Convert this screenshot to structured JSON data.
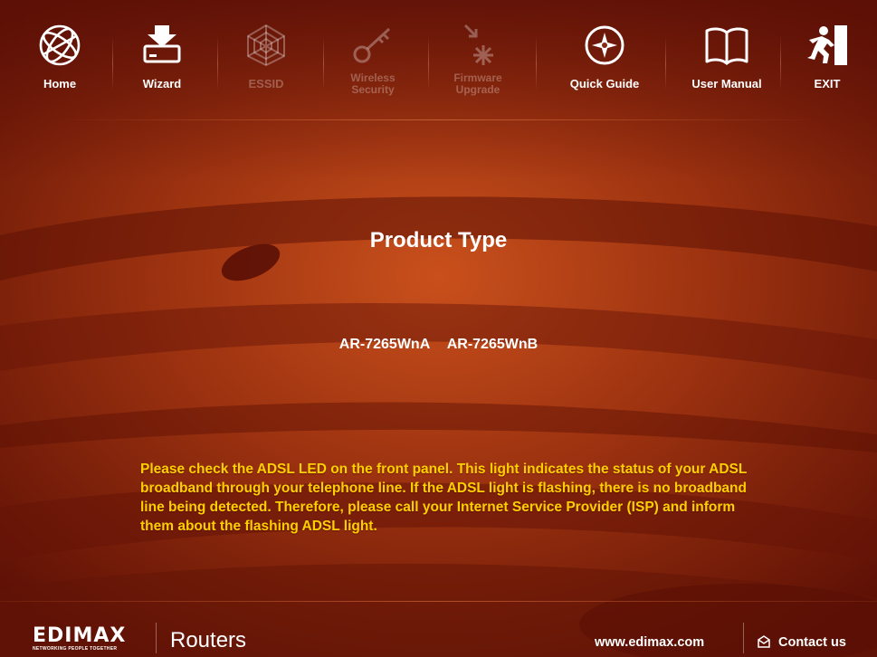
{
  "nav": {
    "items": [
      {
        "label_lines": [
          "Home"
        ],
        "icon": "globe-icon",
        "enabled": true
      },
      {
        "label_lines": [
          "Wizard"
        ],
        "icon": "download-tray-icon",
        "enabled": true
      },
      {
        "label_lines": [
          "ESSID"
        ],
        "icon": "spiderweb-icon",
        "enabled": false
      },
      {
        "label_lines": [
          "Wireless",
          "Security"
        ],
        "icon": "key-icon",
        "enabled": false
      },
      {
        "label_lines": [
          "Firmware",
          "Upgrade"
        ],
        "icon": "firmware-spark-icon",
        "enabled": false
      },
      {
        "label_lines": [
          "Quick Guide"
        ],
        "icon": "compass-icon",
        "enabled": true
      },
      {
        "label_lines": [
          "User Manual"
        ],
        "icon": "open-book-icon",
        "enabled": true
      },
      {
        "label_lines": [
          "EXIT"
        ],
        "icon": "exit-running-man-icon",
        "enabled": true
      }
    ]
  },
  "main": {
    "title": "Product Type",
    "models": [
      "AR-7265WnA",
      "AR-7265WnB"
    ],
    "notice": "Please check the ADSL LED on the front panel. This light indicates the status of your ADSL broadband through your telephone line. If the ADSL light is flashing, there is no broadband line being detected. Therefore, please call your Internet Service Provider (ISP) and inform them about the flashing ADSL light."
  },
  "footer": {
    "brand": "EDIMAX",
    "brand_tagline": "NETWORKING PEOPLE TOGETHER",
    "section": "Routers",
    "website": "www.edimax.com",
    "contact": "Contact us"
  },
  "colors": {
    "background": "#7a1a08",
    "notice_text": "#ffd000",
    "text": "#ffffff"
  }
}
